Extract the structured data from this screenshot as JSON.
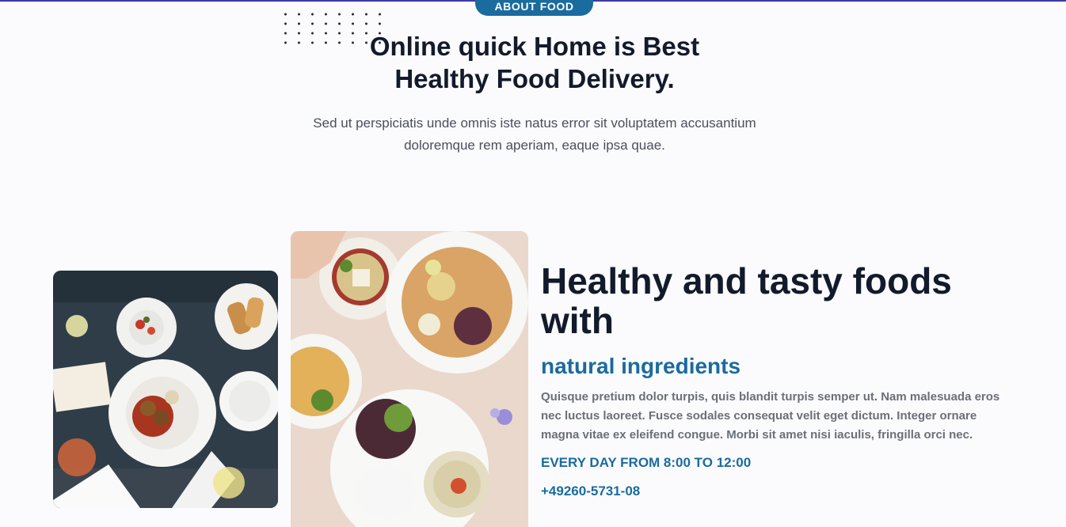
{
  "about_section": {
    "badge": "ABOUT FOOD",
    "title": "Online quick Home is Best Healthy Food Delivery.",
    "description": "Sed ut perspiciatis unde omnis iste natus error sit voluptatem accusantium doloremque rem aperiam, eaque ipsa quae."
  },
  "feature_section": {
    "title": "Healthy and tasty foods with",
    "subtitle": "natural ingredients",
    "body": "Quisque pretium dolor turpis, quis blandit turpis semper ut. Nam malesuada eros nec luctus laoreet. Fusce sodales consequat velit eget dictum. Integer ornare magna vitae ex eleifend congue. Morbi sit amet nisi iaculis, fringilla orci nec.",
    "hours": "EVERY DAY FROM 8:00 TO 12:00",
    "phone": "+49260-5731-08"
  },
  "colors": {
    "accent": "#1a6b9e",
    "heading": "#121a2c",
    "body_text": "#6b6f78",
    "background": "#fbfbfd"
  }
}
